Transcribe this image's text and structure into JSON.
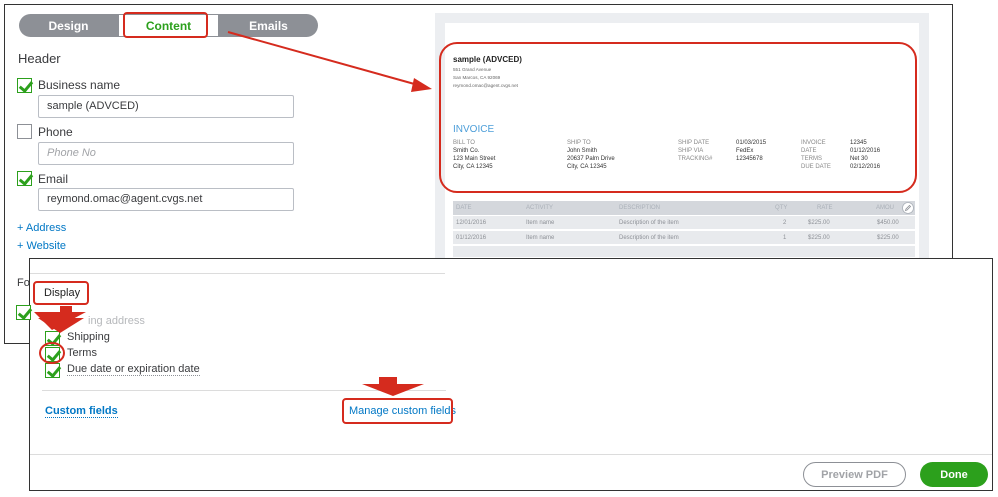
{
  "tabs": [
    {
      "label": "Design",
      "active": false
    },
    {
      "label": "Content",
      "active": true
    },
    {
      "label": "Emails",
      "active": false
    }
  ],
  "header": {
    "title": "Header",
    "business_name": {
      "label": "Business name",
      "checked": true,
      "value": "sample (ADVCED)"
    },
    "phone": {
      "label": "Phone",
      "checked": false,
      "placeholder": "Phone No"
    },
    "email": {
      "label": "Email",
      "checked": true,
      "value": "reymond.omac@agent.cvgs.net"
    },
    "add_address": "+ Address",
    "add_website": "+ Website"
  },
  "preview": {
    "company": "sample (ADVCED)",
    "address_lines": [
      "551 Grand Avenue",
      "San Marcos, CA 92069",
      "reymond.omac@agent.cvgs.net"
    ],
    "invoice_title": "INVOICE",
    "bill_to": {
      "heading": "BILL TO",
      "lines": [
        "Smith Co.",
        "123 Main Street",
        "City, CA 12345"
      ]
    },
    "ship_to": {
      "heading": "SHIP TO",
      "lines": [
        "John Smith",
        "20637 Palm Drive",
        "City, CA 12345"
      ]
    },
    "ship_labels": [
      "SHIP DATE",
      "SHIP VIA",
      "TRACKING#"
    ],
    "ship_values": [
      "01/03/2015",
      "FedEx",
      "12345678"
    ],
    "inv_labels": [
      "INVOICE",
      "DATE",
      "TERMS",
      "DUE DATE"
    ],
    "inv_values": [
      "12345",
      "01/12/2016",
      "Net 30",
      "02/12/2016"
    ],
    "table_headers": [
      "DATE",
      "ACTIVITY",
      "DESCRIPTION",
      "QTY",
      "RATE",
      "AMOU"
    ],
    "rows": [
      [
        "12/01/2016",
        "Item name",
        "Description of the item",
        "2",
        "$225.00",
        "$450.00"
      ],
      [
        "01/12/2016",
        "Item name",
        "Description of the item",
        "1",
        "$225.00",
        "$225.00"
      ]
    ]
  },
  "dialog": {
    "fo_fragment": "Fo",
    "display_label": "Display",
    "billing_address": "ing address",
    "options": [
      {
        "label": "Shipping",
        "checked": true
      },
      {
        "label": "Terms",
        "checked": true
      },
      {
        "label": "Due date or expiration date",
        "checked": true
      }
    ],
    "custom_fields_label": "Custom fields",
    "manage_custom_fields": "Manage custom fields",
    "preview_pdf": "Preview PDF",
    "done": "Done"
  },
  "colors": {
    "brand_green": "#2ca01c",
    "link_blue": "#0077c5",
    "annotation_red": "#d52b1e",
    "tab_gray": "#8d9096"
  }
}
